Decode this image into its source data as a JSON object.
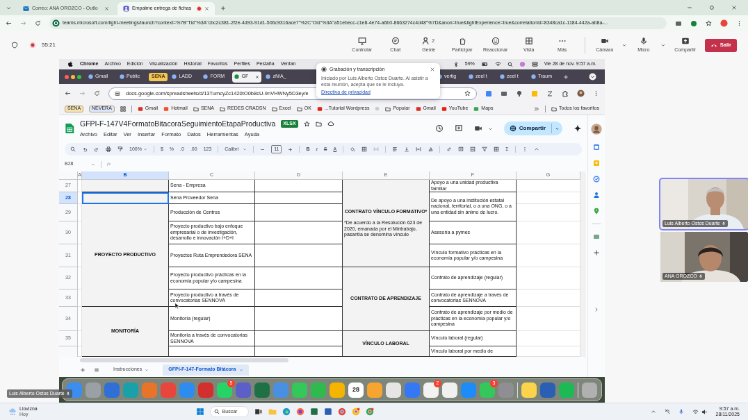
{
  "browser": {
    "tabs": [
      {
        "title": "Correo: ANA OROZCO - Outlo",
        "selected": false,
        "recording": false
      },
      {
        "title": "Empalme entrega de fichas",
        "selected": true,
        "recording": true
      }
    ],
    "url": "teams.microsoft.com/light-meetings/launch?context=%7B\"Tid\"%3A\"cbc2c381-2f2e-4d93-91d1-506c9316ace7\"%2C\"Oid\"%3A\"a51ebecc-c1e8-4e74-a6b0-8663274c4d48\"%7D&anon=true&lightExperience=true&correlationId=8348ca1c-1184-442a-ab8a-..."
  },
  "meeting": {
    "timer": "55:21",
    "actions": [
      {
        "label": "Controlar"
      },
      {
        "label": "Chat"
      },
      {
        "label": "Gente",
        "count": "2"
      },
      {
        "label": "Participar"
      },
      {
        "label": "Reaccionar"
      },
      {
        "label": "Vista"
      },
      {
        "label": "Más"
      }
    ],
    "devices": [
      {
        "label": "Cámara"
      },
      {
        "label": "Micro"
      }
    ],
    "share": "Compartir",
    "leave": "Salir"
  },
  "shared_screen": {
    "menubar": {
      "items": [
        "Chrome",
        "Archivo",
        "Edición",
        "Visualización",
        "Historial",
        "Favoritos",
        "Perfiles",
        "Pestaña",
        "Ventan"
      ],
      "battery": "59%",
      "clock": "Vie 28 de nov.  9:57 a.m."
    },
    "tabs": [
      {
        "title": "Gmail",
        "kind": "tab",
        "selected": false
      },
      {
        "title": "Public",
        "kind": "tab",
        "selected": false
      },
      {
        "title": "SENA",
        "kind": "group",
        "selected": false
      },
      {
        "title": "LADD",
        "kind": "tab",
        "selected": false
      },
      {
        "title": "FORM",
        "kind": "tab",
        "selected": false
      },
      {
        "title": "GF",
        "kind": "tab",
        "selected": true
      },
      {
        "title": "zN/A_",
        "kind": "tab",
        "selected": false
      }
    ],
    "more_tabs": [
      {
        "title": "vertig",
        "kind": "tab",
        "selected": false
      },
      {
        "title": "zeel t",
        "kind": "tab",
        "selected": false
      },
      {
        "title": "zeel t",
        "kind": "tab",
        "selected": false
      },
      {
        "title": "Traum",
        "kind": "tab",
        "selected": false
      }
    ],
    "url": "docs.google.com/spreadsheets/d/13TumcyZc1420tO0b8cU-9nVHWNy5D3ey/e",
    "bookmarks": [
      {
        "label": "SENA",
        "kind": "chip",
        "color": "#f6e3b4"
      },
      {
        "label": "NEVERA",
        "kind": "chip",
        "color": "#dce6fb"
      },
      {
        "label": "Gmail",
        "kind": "link",
        "color": "#d93025"
      },
      {
        "label": "Hotmail",
        "kind": "link",
        "color": "#f25022"
      },
      {
        "label": "SENA",
        "kind": "folder"
      },
      {
        "label": "REDES CRADSN",
        "kind": "folder"
      },
      {
        "label": "Excel",
        "kind": "folder"
      },
      {
        "label": "OK",
        "kind": "folder"
      },
      {
        "label": "...Tutorial Wordpress",
        "kind": "link",
        "color": "#e62117"
      },
      {
        "label": "Popular",
        "kind": "folder"
      },
      {
        "label": "Gmail",
        "kind": "link",
        "color": "#d93025"
      },
      {
        "label": "YouTube",
        "kind": "link",
        "color": "#e62117"
      },
      {
        "label": "Maps",
        "kind": "link",
        "color": "#34a853"
      }
    ],
    "all_bookmarks": "Todos los favoritos",
    "sheets": {
      "title": "GFPI-F-147V4FormatoBitacoraSeguimientoEtapaProductiva",
      "file_type": "XLSX",
      "menu": [
        "Archivo",
        "Editar",
        "Ver",
        "Insertar",
        "Formato",
        "Datos",
        "Herramientas",
        "Ayuda"
      ],
      "share": "Compartir",
      "toolbar": {
        "zoom": "100%",
        "currency": "$",
        "percent": "%",
        "decrease_decimals": ".0",
        "increase_decimals": ".00",
        "number_format": "123",
        "font": "Calibri",
        "font_size": "11",
        "bold": "B",
        "italic": "I",
        "strikethrough": "S",
        "text_color": "A",
        "functions": "Σ"
      },
      "cell_ref": "B28",
      "formula_icon": "fx",
      "columns": [
        "A",
        "B",
        "C",
        "D",
        "E",
        "F",
        "G"
      ],
      "rows": [
        {
          "number": "27",
          "b": {
            "selected": false
          },
          "c": "Sena - Empresa",
          "e": {
            "title": "CONTRATO VÍNCULO FORMATIVO*",
            "note": "*De acuerdo a la Resolución 623 de 2020, emanada por el Mintrabajo, pasantía se denomina vínculo"
          },
          "f": "Apoyo a una unidad productiva familiar"
        },
        {
          "number": "28",
          "b": {
            "selected": true
          },
          "c": "Sena Proveedor Sena",
          "f": "De apoyo a una institución estatal nacional, territorial, o a una ONG, o a una entidad sin ánimo de lucro."
        },
        {
          "number": "29",
          "b": {
            "text": "PROYECTO PRODUCTIVO",
            "selected": false
          },
          "c": "Producción de Centros"
        },
        {
          "number": "30",
          "c": "Proyecto productivo bajo enfoque empresarial o de investigación, desarrollo e innovación I+D+I",
          "f": "Asesoría a pymes"
        },
        {
          "number": "31",
          "c": "Proyectos Ruta Emprendedora SENA",
          "f": "Vínculo formativo  prácticas en la economía popular y/o campesina"
        },
        {
          "number": "32",
          "c": "Proyecto productivo prácticas en la economia popular y/o campesina",
          "e": {
            "title": "CONTRATO DE APRENDIZAJE"
          },
          "f": "Contrato de aprendizaje (regular)"
        },
        {
          "number": "33",
          "c": "Proyecto productivo  a través de convocatorias SENNOVA",
          "f": "Contrato de aprendizaje a través de convocatorias SENNOVA"
        },
        {
          "number": "34",
          "b": {
            "text": "MONITORÍA",
            "selected": false
          },
          "c": "Monitoría (regular)",
          "f": "Contrato de aprendizaje por medio de prácticas en la economía popular y/o campesina"
        },
        {
          "number": "35",
          "c": "Monitoría a través de convocatorias SENNOVA",
          "e": {
            "title": "VÍNCULO LABORAL"
          },
          "f": "Vínculo laboral (regular)"
        },
        {
          "f": "Vínculo laboral por medio de"
        }
      ],
      "sheet_tabs": [
        {
          "label": "Instrucciones",
          "selected": false
        },
        {
          "label": "GFPI-F-147-Formato Bitácora",
          "selected": true
        }
      ]
    },
    "dock": [
      {
        "color": "#3b8ef0"
      },
      {
        "color": "#9aa0a6"
      },
      {
        "color": "#2f6fd6"
      },
      {
        "color": "#1aa0a8"
      },
      {
        "color": "#e8742a"
      },
      {
        "color": "#e8453c"
      },
      {
        "color": "#2d8cf0"
      },
      {
        "color": "#d32f2f"
      },
      {
        "color": "#25d366",
        "badge": "5"
      },
      {
        "color": "#5b5fc7"
      },
      {
        "color": "#1e7145"
      },
      {
        "color": "#4a90e2"
      },
      {
        "color": "#34c759"
      },
      {
        "color": "#30b94d"
      },
      {
        "color": "#f4b400"
      },
      {
        "color": "#ffffff",
        "label": "28"
      },
      {
        "color": "#f7a531"
      },
      {
        "color": "#e5e5e5"
      },
      {
        "color": "#3478f6"
      },
      {
        "color": "#f2f2f2",
        "badge": "2"
      },
      {
        "color": "#f0f0f0"
      },
      {
        "color": "#1d8cf8"
      },
      {
        "color": "#34c759",
        "badge": "3"
      },
      {
        "color": "#8e8e93"
      },
      {
        "color": "#fbd44c"
      },
      {
        "color": "#2b5fb4"
      },
      {
        "color": "#1db954"
      },
      {
        "color": "#b0b0b0"
      }
    ]
  },
  "notification": {
    "title": "Grabación y transcripción",
    "body": "Iniciado por Luis Alberto Ostos Duarte. Al asistir a esta reunión, acepta que se le incluya.",
    "link": "Directiva de privacidad"
  },
  "presenter": "Luis Alberto Ostos Duarte",
  "participants": [
    {
      "name": "Luis Alberto Ostos Duarte",
      "active_speaker": true
    },
    {
      "name": "ANA OROZCO",
      "active_speaker": false
    }
  ],
  "taskbar": {
    "weather": "Llovizna",
    "weather_day": "Hoy",
    "search": "Buscar",
    "time": "9:57 a.m.",
    "date": "28/11/2025"
  }
}
